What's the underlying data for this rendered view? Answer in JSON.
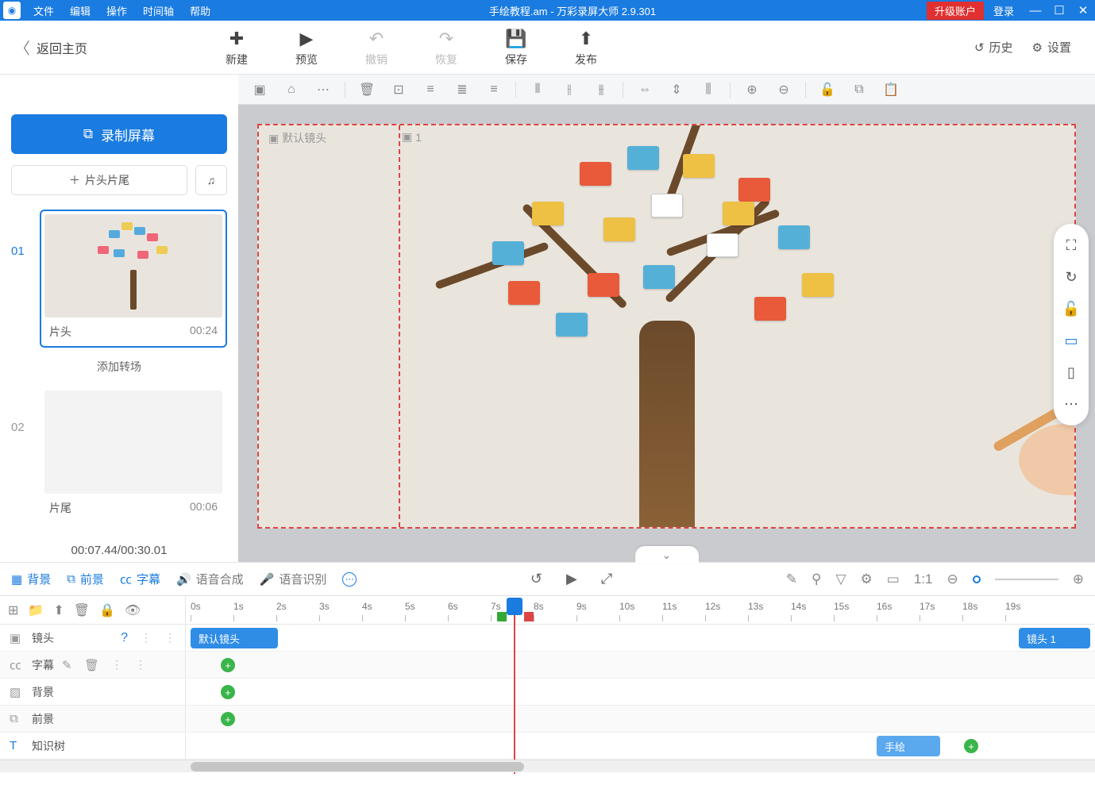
{
  "titlebar": {
    "menus": [
      "文件",
      "编辑",
      "操作",
      "时间轴",
      "帮助"
    ],
    "title": "手绘教程.am - 万彩录屏大师 2.9.301",
    "upgrade": "升级账户",
    "login": "登录"
  },
  "back_home": "返回主页",
  "big_actions": {
    "new": "新建",
    "preview": "预览",
    "undo": "撤销",
    "redo": "恢复",
    "save": "保存",
    "publish": "发布"
  },
  "top_right": {
    "history": "历史",
    "settings": "设置"
  },
  "left": {
    "record": "录制屏幕",
    "intro_outro": "片头片尾",
    "scenes": [
      {
        "num": "01",
        "name": "片头",
        "duration": "00:24",
        "selected": true
      },
      {
        "num": "02",
        "name": "片尾",
        "duration": "00:06",
        "selected": false
      }
    ],
    "add_transition": "添加转场",
    "time_footer": "00:07.44/00:30.01"
  },
  "canvas": {
    "label1": "默认镜头",
    "label2": "1"
  },
  "bottom_tabs": {
    "bg": "背景",
    "fg": "前景",
    "subtitle": "字幕",
    "tts": "语音合成",
    "asr": "语音识别"
  },
  "timeline": {
    "seconds": [
      "0s",
      "1s",
      "2s",
      "3s",
      "4s",
      "5s",
      "6s",
      "7s",
      "8s",
      "9s",
      "10s",
      "11s",
      "12s",
      "13s",
      "14s",
      "15s",
      "16s",
      "17s",
      "18s",
      "19s"
    ],
    "rows": {
      "camera": "镜头",
      "subtitle": "字幕",
      "bg": "背景",
      "fg": "前景",
      "text1": "知识树"
    },
    "blocks": {
      "default_camera": "默认镜头",
      "camera1": "镜头 1",
      "handdraw": "手绘"
    }
  }
}
